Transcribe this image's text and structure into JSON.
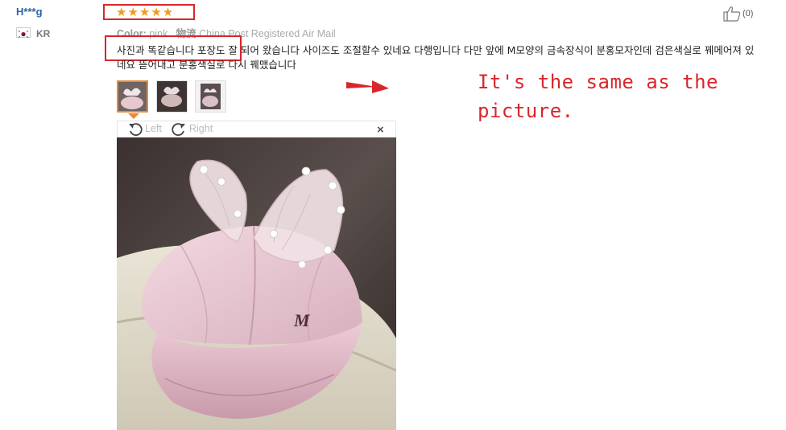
{
  "reviewer": {
    "name": "H***g",
    "country": "KR"
  },
  "rating": {
    "stars": 5,
    "stars_text": "★★★★★"
  },
  "helpful": {
    "count": "(0)"
  },
  "meta": {
    "color_label": "Color:",
    "color_value": "pink",
    "logistics_label": "物流",
    "logistics_value": "China Post Registered Air Mail"
  },
  "review": {
    "text": "사진과 똑같습니다 포장도 잘 되어 왔습니다 사이즈도 조절할수 있네요 다행입니다 다만 앞에 M모양의 금속장식이 분홍모자인데 검은색실로 꿰메어져 있네요 뜯어내고 분홍색실로 다시 꿰맸습니다"
  },
  "annotation": {
    "line1": "It's the same as the",
    "line2": "picture."
  },
  "viewer": {
    "left_label": "Left",
    "right_label": "Right",
    "close_label": "×"
  },
  "colors": {
    "username": "#2a63a8",
    "highlight_box": "#d9262b",
    "star": "#f39a18",
    "active_thumb": "#ec8a32"
  }
}
